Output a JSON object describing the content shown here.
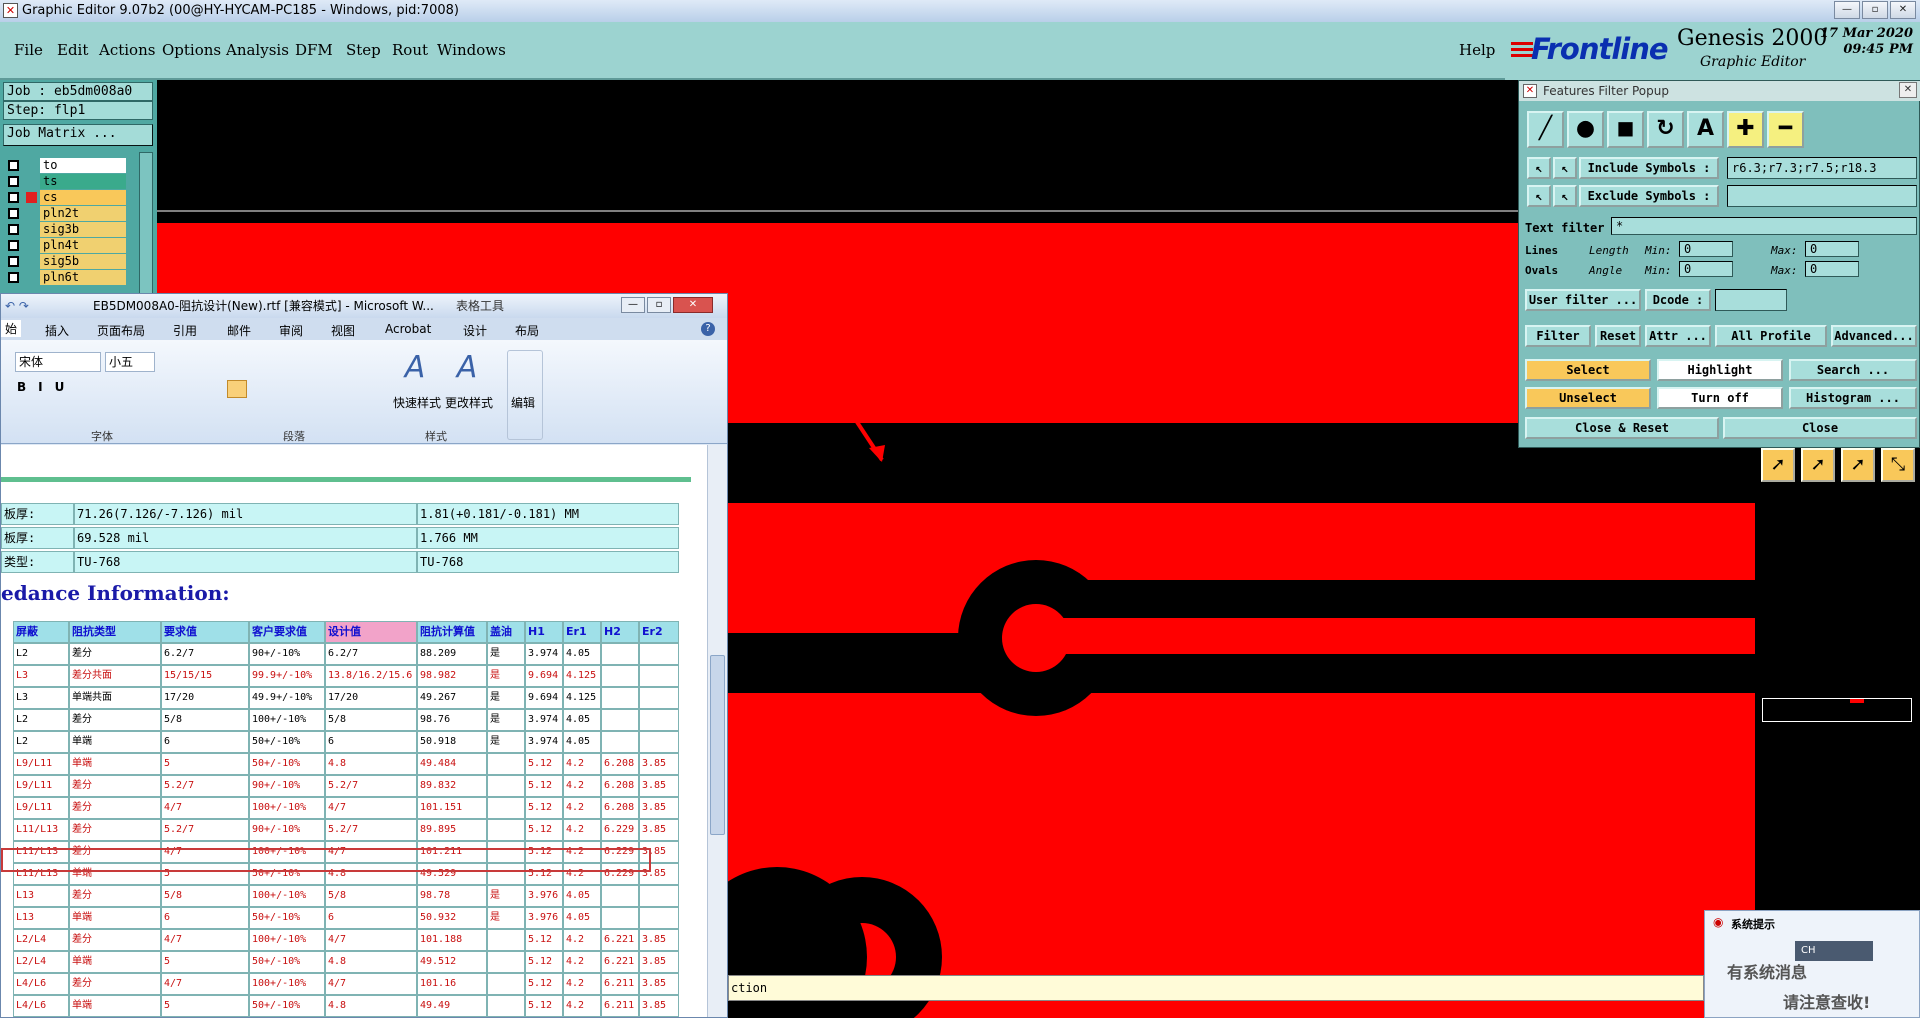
{
  "window": {
    "title": "Graphic Editor 9.07b2 (00@HY-HYCAM-PC185 - Windows, pid:7008)"
  },
  "menu": [
    "File",
    "Edit",
    "Actions",
    "Options",
    "Analysis",
    "DFM",
    "Step",
    "Rout",
    "Windows"
  ],
  "help_label": "Help",
  "brand": {
    "name": "Frontline",
    "product": "Genesis 2000",
    "sub": "Graphic Editor",
    "date": "17 Mar 2020",
    "time": "09:45 PM"
  },
  "job": {
    "job_label": "Job : eb5dm008a0",
    "step_label": "Step: flp1",
    "matrix_button": "Job Matrix ..."
  },
  "layers": [
    {
      "name": "to",
      "color": "#ffffff"
    },
    {
      "name": "ts",
      "color": "#3aaa8c"
    },
    {
      "name": "cs",
      "color": "#f9c85a"
    },
    {
      "name": "pln2t",
      "color": "#f0d070"
    },
    {
      "name": "sig3b",
      "color": "#f0d070"
    },
    {
      "name": "pln4t",
      "color": "#f0d070"
    },
    {
      "name": "sig5b",
      "color": "#f0d070"
    },
    {
      "name": "pln6t",
      "color": "#f0d070"
    }
  ],
  "word": {
    "title": "EB5DM008A0-阻抗设计(New).rtf [兼容模式] - Microsoft W...",
    "context_tab": "表格工具",
    "tabs": [
      "始",
      "插入",
      "页面布局",
      "引用",
      "邮件",
      "审阅",
      "视图",
      "Acrobat",
      "设计",
      "布局"
    ],
    "font_name": "宋体",
    "font_size": "小五",
    "groups": [
      "字体",
      "段落",
      "样式"
    ],
    "style_buttons": [
      "快速样式",
      "更改样式",
      "编辑"
    ],
    "info_rows": [
      [
        "板厚:",
        "71.26(7.126/-7.126) mil",
        "1.81(+0.181/-0.181) MM"
      ],
      [
        "板厚:",
        "69.528 mil",
        "1.766 MM"
      ],
      [
        "类型:",
        "TU-768",
        "TU-768"
      ]
    ],
    "section_heading": "edance Information:",
    "headers": [
      "屏蔽",
      "阻抗类型",
      "要求值",
      "客户要求值",
      "设计值",
      "阻抗计算值",
      "盖油",
      "H1",
      "Er1",
      "H2",
      "Er2"
    ],
    "rows": [
      {
        "c": [
          "L2",
          "差分",
          "6.2/7",
          "90+/-10%",
          "6.2/7",
          "88.209",
          "是",
          "3.974",
          "4.05",
          "",
          ""
        ],
        "red": false
      },
      {
        "c": [
          "L3",
          "差分共面",
          "15/15/15",
          "99.9+/-10%",
          "13.8/16.2/15.6",
          "98.982",
          "是",
          "9.694",
          "4.125",
          "",
          ""
        ],
        "red": true
      },
      {
        "c": [
          "L3",
          "单端共面",
          "17/20",
          "49.9+/-10%",
          "17/20",
          "49.267",
          "是",
          "9.694",
          "4.125",
          "",
          ""
        ],
        "red": false
      },
      {
        "c": [
          "L2",
          "差分",
          "5/8",
          "100+/-10%",
          "5/8",
          "98.76",
          "是",
          "3.974",
          "4.05",
          "",
          ""
        ],
        "red": false
      },
      {
        "c": [
          "L2",
          "单端",
          "6",
          "50+/-10%",
          "6",
          "50.918",
          "是",
          "3.974",
          "4.05",
          "",
          ""
        ],
        "red": false
      },
      {
        "c": [
          "L9/L11",
          "单端",
          "5",
          "50+/-10%",
          "4.8",
          "49.484",
          "",
          "5.12",
          "4.2",
          "6.208",
          "3.85"
        ],
        "red": true
      },
      {
        "c": [
          "L9/L11",
          "差分",
          "5.2/7",
          "90+/-10%",
          "5.2/7",
          "89.832",
          "",
          "5.12",
          "4.2",
          "6.208",
          "3.85"
        ],
        "red": true
      },
      {
        "c": [
          "L9/L11",
          "差分",
          "4/7",
          "100+/-10%",
          "4/7",
          "101.151",
          "",
          "5.12",
          "4.2",
          "6.208",
          "3.85"
        ],
        "red": true
      },
      {
        "c": [
          "L11/L13",
          "差分",
          "5.2/7",
          "90+/-10%",
          "5.2/7",
          "89.895",
          "",
          "5.12",
          "4.2",
          "6.229",
          "3.85"
        ],
        "red": true
      },
      {
        "c": [
          "L11/L13",
          "差分",
          "4/7",
          "100+/-10%",
          "4/7",
          "101.211",
          "",
          "5.12",
          "4.2",
          "6.229",
          "3.85"
        ],
        "red": true
      },
      {
        "c": [
          "L11/L13",
          "单端",
          "5",
          "50+/-10%",
          "4.8",
          "49.529",
          "",
          "5.12",
          "4.2",
          "6.229",
          "3.85"
        ],
        "red": true
      },
      {
        "c": [
          "L13",
          "差分",
          "5/8",
          "100+/-10%",
          "5/8",
          "98.78",
          "是",
          "3.976",
          "4.05",
          "",
          ""
        ],
        "red": true
      },
      {
        "c": [
          "L13",
          "单端",
          "6",
          "50+/-10%",
          "6",
          "50.932",
          "是",
          "3.976",
          "4.05",
          "",
          ""
        ],
        "red": true
      },
      {
        "c": [
          "L2/L4",
          "差分",
          "4/7",
          "100+/-10%",
          "4/7",
          "101.188",
          "",
          "5.12",
          "4.2",
          "6.221",
          "3.85"
        ],
        "red": true
      },
      {
        "c": [
          "L2/L4",
          "单端",
          "5",
          "50+/-10%",
          "4.8",
          "49.512",
          "",
          "5.12",
          "4.2",
          "6.221",
          "3.85"
        ],
        "red": true
      },
      {
        "c": [
          "L4/L6",
          "差分",
          "4/7",
          "100+/-10%",
          "4/7",
          "101.16",
          "",
          "5.12",
          "4.2",
          "6.211",
          "3.85"
        ],
        "red": true
      },
      {
        "c": [
          "L4/L6",
          "单端",
          "5",
          "50+/-10%",
          "4.8",
          "49.49",
          "",
          "5.12",
          "4.2",
          "6.211",
          "3.85"
        ],
        "red": true
      }
    ]
  },
  "filter": {
    "title": "Features Filter Popup",
    "include_label": "Include Symbols :",
    "include_value": "r6.3;r7.3;r7.5;r18.3",
    "exclude_label": "Exclude Symbols :",
    "text_filter_label": "Text filter",
    "text_filter_value": "*",
    "lines_label": "Lines",
    "ovals_label": "Ovals",
    "length_label": "Length",
    "angle_label": "Angle",
    "min_label": "Min:",
    "max_label": "Max:",
    "zero": "0",
    "user_filter": "User filter ...",
    "dcode": "Dcode :",
    "filter_label": "Filter",
    "reset": "Reset",
    "attr": "Attr ...",
    "all_profile": "All Profile",
    "advanced": "Advanced...",
    "select": "Select",
    "highlight": "Highlight",
    "search": "Search ...",
    "unselect": "Unselect",
    "turn_off": "Turn off",
    "histogram": "Histogram ...",
    "close_reset": "Close & Reset",
    "close": "Close"
  },
  "status_text": "ction",
  "notification": {
    "title": "系统提示",
    "ime": "CH",
    "line1": "有系统消息",
    "line2": "请注意查收!"
  },
  "colors": {
    "copper": "#ff0000",
    "background": "#000000",
    "teal": "#9cd3d0"
  }
}
